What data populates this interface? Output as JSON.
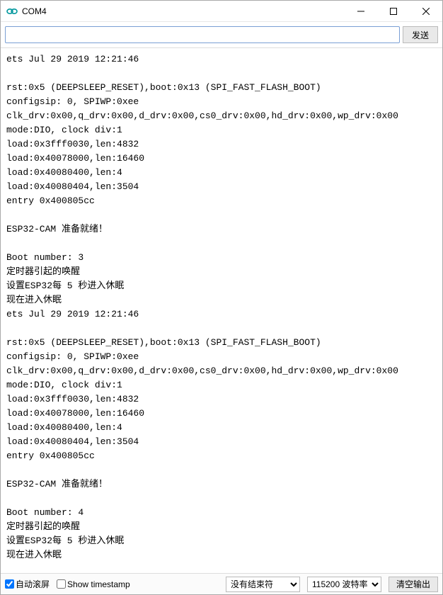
{
  "title": "COM4",
  "input": {
    "value": "",
    "placeholder": ""
  },
  "send_button_label": "发送",
  "console_lines": [
    "ets Jul 29 2019 12:21:46",
    "",
    "rst:0x5 (DEEPSLEEP_RESET),boot:0x13 (SPI_FAST_FLASH_BOOT)",
    "configsip: 0, SPIWP:0xee",
    "clk_drv:0x00,q_drv:0x00,d_drv:0x00,cs0_drv:0x00,hd_drv:0x00,wp_drv:0x00",
    "mode:DIO, clock div:1",
    "load:0x3fff0030,len:4832",
    "load:0x40078000,len:16460",
    "load:0x40080400,len:4",
    "load:0x40080404,len:3504",
    "entry 0x400805cc",
    "",
    "ESP32-CAM 准备就绪！",
    "",
    "Boot number: 3",
    "定时器引起的唤醒",
    "设置ESP32每 5 秒进入休眠",
    "现在进入休眠",
    "ets Jul 29 2019 12:21:46",
    "",
    "rst:0x5 (DEEPSLEEP_RESET),boot:0x13 (SPI_FAST_FLASH_BOOT)",
    "configsip: 0, SPIWP:0xee",
    "clk_drv:0x00,q_drv:0x00,d_drv:0x00,cs0_drv:0x00,hd_drv:0x00,wp_drv:0x00",
    "mode:DIO, clock div:1",
    "load:0x3fff0030,len:4832",
    "load:0x40078000,len:16460",
    "load:0x40080400,len:4",
    "load:0x40080404,len:3504",
    "entry 0x400805cc",
    "",
    "ESP32-CAM 准备就绪！",
    "",
    "Boot number: 4",
    "定时器引起的唤醒",
    "设置ESP32每 5 秒进入休眠",
    "现在进入休眠"
  ],
  "statusbar": {
    "autoscroll_label": "自动滚屏",
    "autoscroll_checked": true,
    "timestamp_label": "Show timestamp",
    "timestamp_checked": false,
    "line_ending_selected": "没有结束符",
    "baud_selected": "115200 波特率",
    "clear_label": "清空输出"
  }
}
